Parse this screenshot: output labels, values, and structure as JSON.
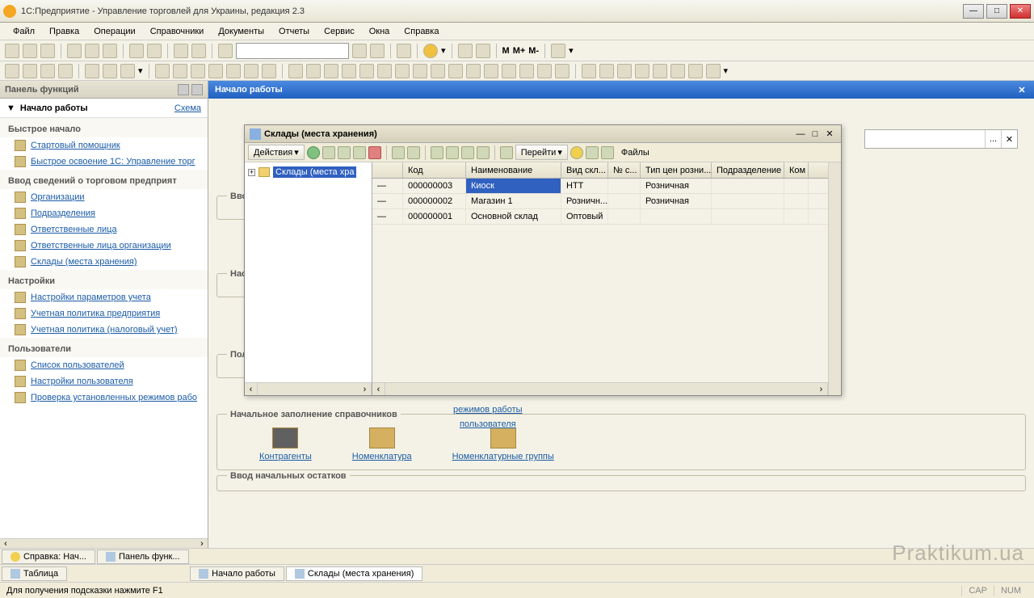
{
  "app": {
    "title": "1С:Предприятие - Управление торговлей для Украины, редакция 2.3"
  },
  "menu": [
    "Файл",
    "Правка",
    "Операции",
    "Справочники",
    "Документы",
    "Отчеты",
    "Сервис",
    "Окна",
    "Справка"
  ],
  "left_panel": {
    "title": "Панель функций",
    "start_header": "Начало работы",
    "schema_link": "Схема",
    "groups": [
      {
        "title": "Быстрое начало",
        "items": [
          "Стартовый помощник",
          "Быстрое освоение 1С: Управление торг"
        ]
      },
      {
        "title": "Ввод сведений о торговом предприят",
        "items": [
          "Организации",
          "Подразделения",
          "Ответственные лица",
          "Ответственные лица организации",
          "Склады (места хранения)"
        ]
      },
      {
        "title": "Настройки",
        "items": [
          "Настройки параметров учета",
          "Учетная политика предприятия",
          "Учетная политика (налоговый учет)"
        ]
      },
      {
        "title": "Пользователи",
        "items": [
          "Список пользователей",
          "Настройки пользователя",
          "Проверка установленных режимов рабо"
        ]
      }
    ]
  },
  "main": {
    "title": "Начало работы",
    "blocks": {
      "b1": "Ввод",
      "b2": "Наст",
      "b3": "Поль",
      "user_link1": "режимов работы",
      "user_link2": "пользователя"
    },
    "refs": {
      "title": "Начальное заполнение справочников",
      "items": [
        "Контрагенты",
        "Номенклатура",
        "Номенклатурные группы"
      ]
    },
    "balances_title": "Ввод начальных остатков"
  },
  "popup": {
    "title": "Склады (места хранения)",
    "actions_label": "Действия",
    "goto_label": "Перейти",
    "files_label": "Файлы",
    "tree_root": "Склады (места хра",
    "columns": [
      "",
      "Код",
      "Наименование",
      "Вид скл...",
      "№ с...",
      "Тип цен розни...",
      "Подразделение",
      "Ком"
    ],
    "rows": [
      {
        "code": "000000003",
        "name": "Киоск",
        "type": "НТТ",
        "num": "",
        "price": "Розничная",
        "dept": "",
        "com": ""
      },
      {
        "code": "000000002",
        "name": "Магазин 1",
        "type": "Розничн...",
        "num": "",
        "price": "Розничная",
        "dept": "",
        "com": ""
      },
      {
        "code": "000000001",
        "name": "Основной склад",
        "type": "Оптовый",
        "num": "",
        "price": "",
        "dept": "",
        "com": ""
      }
    ]
  },
  "bottom_tabs": [
    "Таблица",
    "Справка: Нач...",
    "Панель функ...",
    "Начало работы",
    "Склады (места хранения)"
  ],
  "statusbar": {
    "hint": "Для получения подсказки нажмите F1",
    "cap": "CAP",
    "num": "NUM"
  },
  "watermark": "Praktikum.ua"
}
